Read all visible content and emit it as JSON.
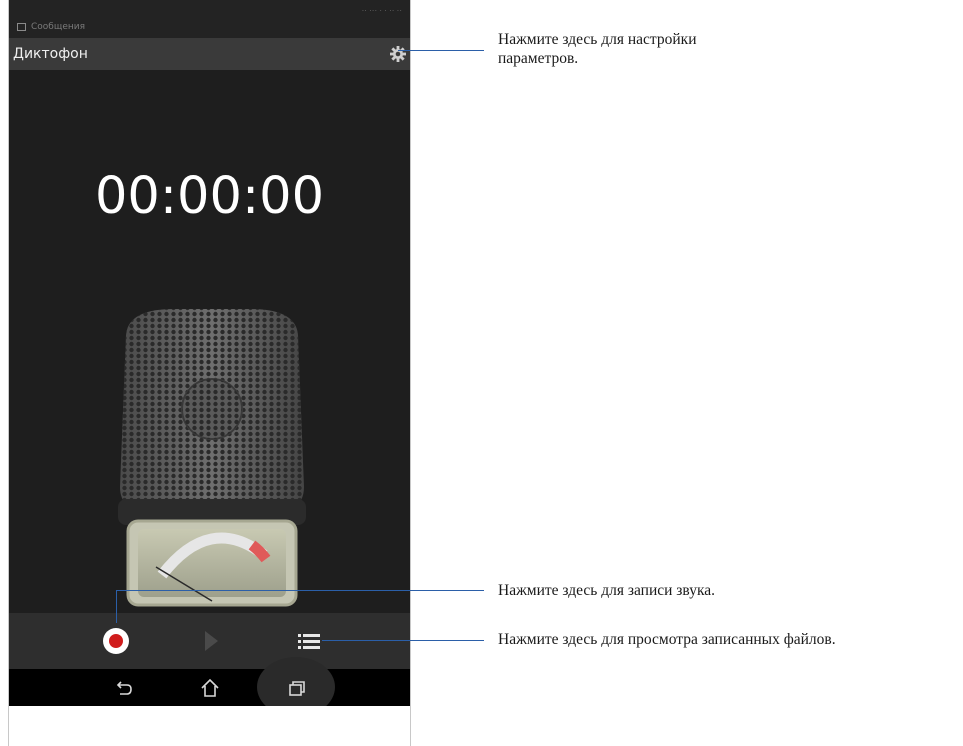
{
  "status_bar": {
    "notification_text": "Сообщения",
    "right_text": "·· ··· · · ·· ··"
  },
  "app": {
    "title": "Диктофон",
    "timer": "00:00:00"
  },
  "icons": {
    "settings": "gear-icon",
    "record": "record-icon",
    "play": "play-icon",
    "list": "list-icon",
    "back": "back-icon",
    "home": "home-icon",
    "recents": "recent-apps-icon"
  },
  "colors": {
    "record_red": "#d01c1c",
    "callout_blue": "#2b5fa8",
    "meter_needle_zone": "#e05a5a"
  },
  "callouts": {
    "settings": "Нажмите здесь для настройки параметров.",
    "settings_line1": "Нажмите здесь для настройки",
    "settings_line2": "параметров.",
    "record": "Нажмите здесь для записи звука.",
    "files": "Нажмите здесь для просмотра записанных файлов."
  }
}
